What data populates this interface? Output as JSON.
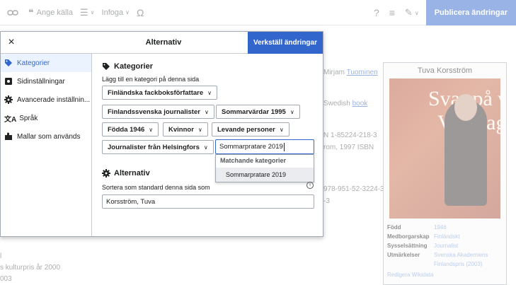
{
  "toolbar": {
    "cite_label": "Ange källa",
    "insert_label": "Infoga",
    "special_char": "Ω",
    "help": "?",
    "publish_label": "Publicera ändringar"
  },
  "background": {
    "line1_pre": "Mirjam ",
    "line1_link": "Tuominen",
    "line2_pre": "Swedish ",
    "line2_link": "book",
    "line3": "N 1-85224-218-3",
    "line4": "rom, 1997 ISBN",
    "line5": "978-951-52-3224-3",
    "line6": "-3",
    "footer1": "l",
    "footer2": "s kulturpris år 2000",
    "footer3": "003"
  },
  "infobox": {
    "title": "Tuva Korsström",
    "image_text1": "Svar på v",
    "image_text2": "Van dag",
    "rows": [
      {
        "k": "Född",
        "v": "1946"
      },
      {
        "k": "Medborgarskap",
        "v": "Finländskt"
      },
      {
        "k": "Sysselsättning",
        "v": "Journalist"
      },
      {
        "k": "Utmärkelser",
        "v": "Svenska Akademiens"
      },
      {
        "k": "",
        "v": "Finlandspris (2003)"
      }
    ],
    "wikidata": "Redigera Wikidata"
  },
  "dialog": {
    "title": "Alternativ",
    "apply_label": "Verkställ ändringar",
    "close": "×",
    "sidebar": [
      {
        "label": "Kategorier",
        "icon": "tag-icon"
      },
      {
        "label": "Sidinställningar",
        "icon": "page-settings-icon"
      },
      {
        "label": "Avancerade inställnin...",
        "icon": "advanced-settings-icon"
      },
      {
        "label": "Språk",
        "icon": "language-icon"
      },
      {
        "label": "Mallar som används",
        "icon": "puzzle-icon"
      }
    ],
    "categories": {
      "title": "Kategorier",
      "hint": "Lägg till en kategori på denna sida",
      "chips": [
        "Finländska fackboksförfattare",
        "Finlandssvenska journalister",
        "Sommarvärdar 1995",
        "Födda 1946",
        "Kvinnor",
        "Levande personer",
        "Journalister från Helsingfors"
      ],
      "input_value": "Sommarpratare 2019",
      "menu_header": "Matchande kategorier",
      "menu_item": "Sommarpratare 2019"
    },
    "options": {
      "title": "Alternativ",
      "sort_label": "Sortera som standard denna sida som",
      "sort_value": "Korsström, Tuva",
      "info": "i"
    }
  },
  "colors": {
    "accent": "#3366cc",
    "active_bg": "#eaf3ff"
  }
}
